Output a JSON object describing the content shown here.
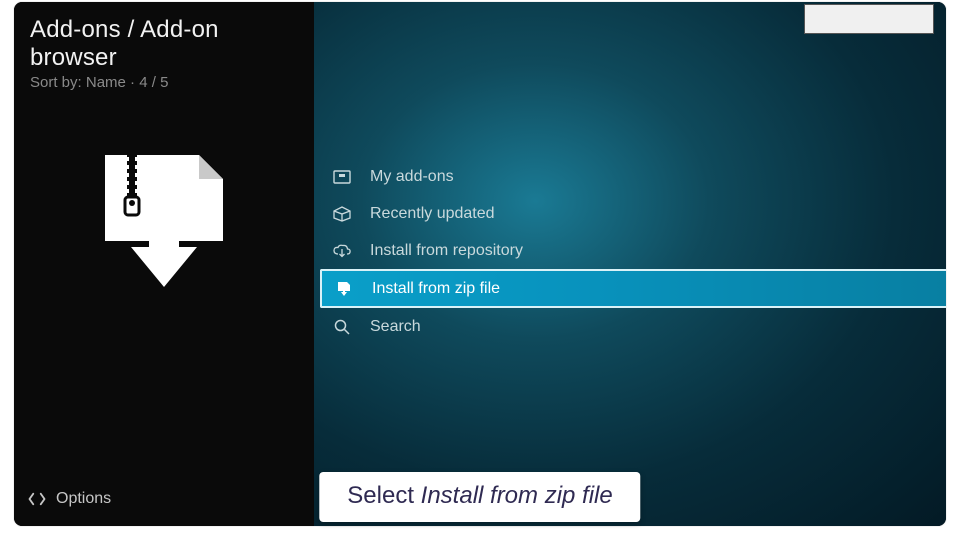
{
  "header": {
    "breadcrumb": "Add-ons / Add-on browser",
    "sort_label": "Sort by:",
    "sort_value": "Name",
    "position": "4 / 5"
  },
  "menu": {
    "items": [
      {
        "label": "My add-ons",
        "icon": "addons-icon",
        "selected": false
      },
      {
        "label": "Recently updated",
        "icon": "box-icon",
        "selected": false
      },
      {
        "label": "Install from repository",
        "icon": "cloud-download-icon",
        "selected": false
      },
      {
        "label": "Install from zip file",
        "icon": "zip-download-icon",
        "selected": true
      },
      {
        "label": "Search",
        "icon": "search-icon",
        "selected": false
      }
    ]
  },
  "footer": {
    "options_label": "Options"
  },
  "caption": {
    "prefix": "Select ",
    "emphasis": "Install from zip file"
  }
}
